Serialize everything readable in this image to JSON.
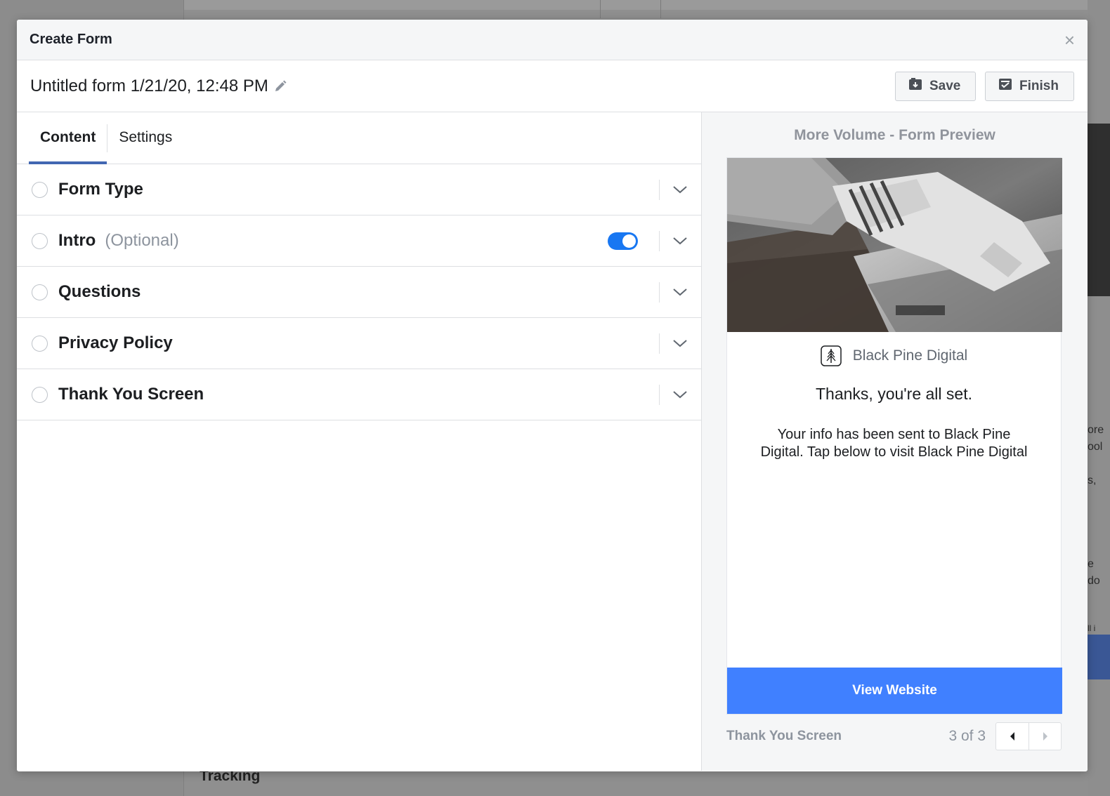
{
  "modal": {
    "title": "Create Form",
    "close_label": "×"
  },
  "toolbar": {
    "form_name": "Untitled form 1/21/20, 12:48 PM",
    "save_label": "Save",
    "finish_label": "Finish"
  },
  "tabs": [
    {
      "label": "Content",
      "active": true
    },
    {
      "label": "Settings",
      "active": false
    }
  ],
  "sections": [
    {
      "label": "Form Type"
    },
    {
      "label": "Intro",
      "optional_label": "(Optional)",
      "toggle_on": true
    },
    {
      "label": "Questions"
    },
    {
      "label": "Privacy Policy"
    },
    {
      "label": "Thank You Screen"
    }
  ],
  "preview": {
    "title": "More Volume - Form Preview",
    "brand_name": "Black Pine Digital",
    "heading": "Thanks, you're all set.",
    "body": "Your info has been sent to Black Pine Digital. Tap below to visit Black Pine Digital",
    "button_label": "View Website",
    "screen_name": "Thank You Screen",
    "page_count": "3 of 3"
  },
  "background": {
    "bottom_text": "Tracking",
    "fragments": [
      "ore",
      "ool",
      "s,",
      "e",
      "do",
      "ll i"
    ]
  },
  "colors": {
    "accent_blue": "#4267b2",
    "button_blue": "#4080ff",
    "toggle_blue": "#1877f2"
  },
  "icons": {
    "close": "close-icon",
    "edit": "pencil-icon",
    "save": "save-icon",
    "finish": "finish-icon",
    "chevron": "chevron-down-icon",
    "brand": "pine-tree-icon",
    "prev": "arrow-left-icon",
    "next": "arrow-right-icon"
  }
}
